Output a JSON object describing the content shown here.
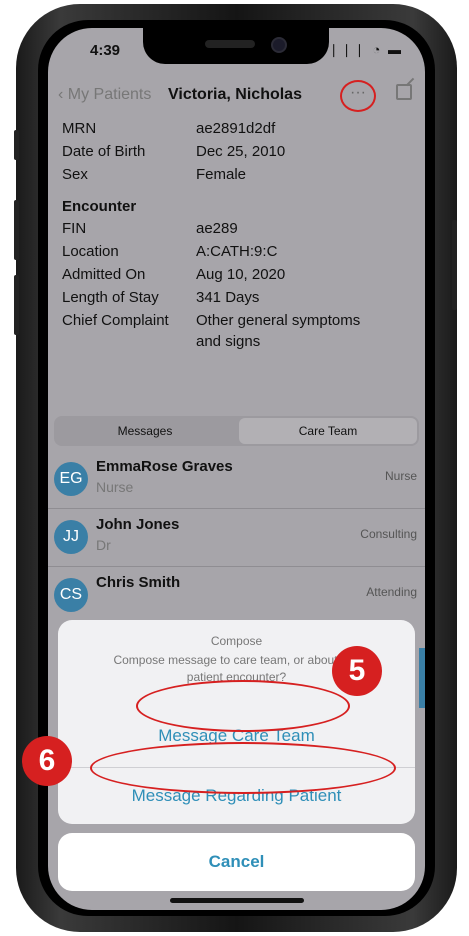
{
  "status": {
    "time": "4:39",
    "icons": "❘❘❘ ◔ ▬"
  },
  "nav": {
    "back": "‹ My Patients",
    "title": "Victoria, Nicholas",
    "more": "···"
  },
  "patient": {
    "mrn_label": "MRN",
    "mrn": "ae2891d2df",
    "dob_label": "Date of Birth",
    "dob": "Dec 25, 2010",
    "sex_label": "Sex",
    "sex": "Female"
  },
  "encounter": {
    "heading": "Encounter",
    "fin_label": "FIN",
    "fin": "ae289",
    "location_label": "Location",
    "location": "A:CATH:9:C",
    "admitted_label": "Admitted On",
    "admitted": "Aug 10, 2020",
    "stay_label": "Length of Stay",
    "stay": "341 Days",
    "complaint_label": "Chief Complaint",
    "complaint_line1": "Other general symptoms",
    "complaint_line2": "and signs"
  },
  "tabs": {
    "messages": "Messages",
    "care_team": "Care Team",
    "selected": "Care Team"
  },
  "care_team": [
    {
      "initials": "EG",
      "name": "EmmaRose Graves",
      "sub": "Nurse",
      "role": "Nurse"
    },
    {
      "initials": "JJ",
      "name": "John Jones",
      "sub": "Dr",
      "role": "Consulting"
    },
    {
      "initials": "CS",
      "name": "Chris Smith",
      "sub": "",
      "role": "Attending"
    }
  ],
  "sheet": {
    "title": "Compose",
    "message_line1": "Compose message to care team, or about this",
    "message_line2": "patient encounter?",
    "option1": "Message Care Team",
    "option2": "Message Regarding Patient",
    "cancel": "Cancel"
  },
  "annotations": {
    "badge5": "5",
    "badge6": "6"
  },
  "colors": {
    "accent": "#2f8fb8",
    "avatar": "#3a7fa6",
    "annotation": "#d62020"
  }
}
